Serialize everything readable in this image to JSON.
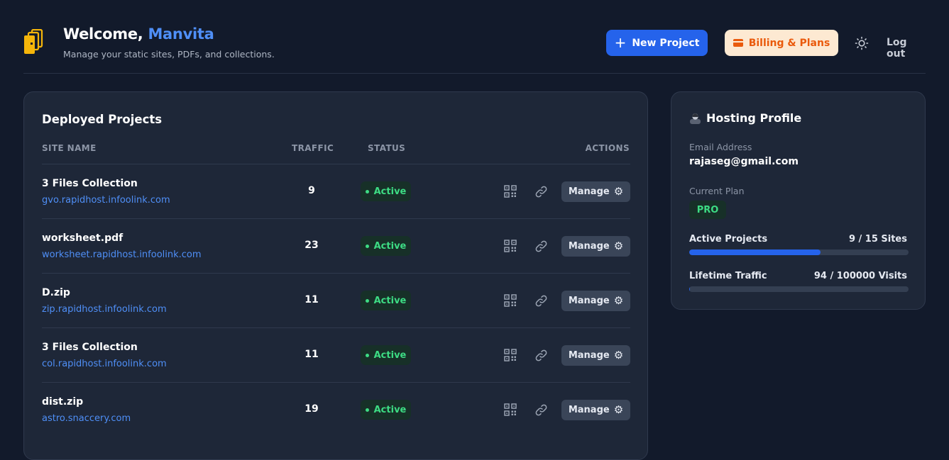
{
  "header": {
    "welcome_prefix": "Welcome, ",
    "user_name": "Manvita",
    "subtitle": "Manage your static sites, PDFs, and collections.",
    "new_project_label": "New Project",
    "billing_label": "Billing & Plans",
    "logout_label": "Log out"
  },
  "projects": {
    "title": "Deployed Projects",
    "columns": [
      "SITE NAME",
      "TRAFFIC",
      "STATUS",
      "ACTIONS"
    ],
    "rows": [
      {
        "name": "3 Files Collection",
        "url": "gvo.rapidhost.infoolink.com",
        "traffic": "9",
        "status": "Active",
        "manage": "Manage"
      },
      {
        "name": "worksheet.pdf",
        "url": "worksheet.rapidhost.infoolink.com",
        "traffic": "23",
        "status": "Active",
        "manage": "Manage"
      },
      {
        "name": "D.zip",
        "url": "zip.rapidhost.infoolink.com",
        "traffic": "11",
        "status": "Active",
        "manage": "Manage"
      },
      {
        "name": "3 Files Collection",
        "url": "col.rapidhost.infoolink.com",
        "traffic": "11",
        "status": "Active",
        "manage": "Manage"
      },
      {
        "name": "dist.zip",
        "url": "astro.snaccery.com",
        "traffic": "19",
        "status": "Active",
        "manage": "Manage"
      }
    ]
  },
  "profile": {
    "title": "Hosting Profile",
    "email_label": "Email Address",
    "email": "rajaseg@gmail.com",
    "plan_label": "Current Plan",
    "plan": "PRO",
    "active_projects_label": "Active Projects",
    "active_projects_value": "9 / 15 Sites",
    "active_projects_fraction": 0.6,
    "traffic_label": "Lifetime Traffic",
    "traffic_value": "94 / 100000 Visits",
    "traffic_fraction": 0.00094
  },
  "colors": {
    "background": "#121a2b",
    "card": "#1e2738",
    "accent": "#2563eb",
    "link": "#4f8ff7",
    "active_green": "#3ddc84",
    "billing_bg": "#fde9d2",
    "billing_text": "#ea5a0c",
    "logo": "#f5b50a"
  },
  "icons": [
    "folder-stack-icon",
    "plus-icon",
    "credit-card-icon",
    "sun-icon",
    "qr-code-icon",
    "link-icon",
    "gear-icon",
    "user-avatar-icon"
  ]
}
